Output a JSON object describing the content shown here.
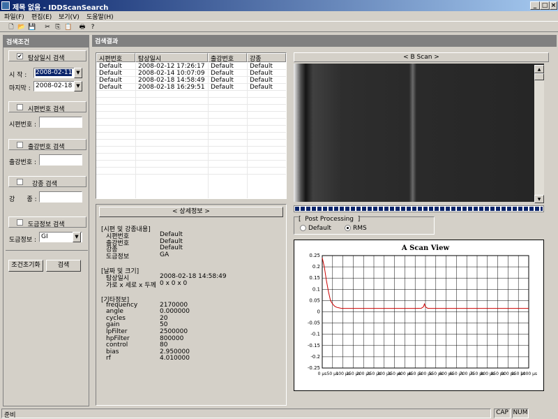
{
  "window": {
    "title": "제목 없음 - IDDScanSearch"
  },
  "menu": [
    "파일(F)",
    "편집(E)",
    "보기(V)",
    "도움말(H)"
  ],
  "left": {
    "header": "검색조건",
    "date_search": {
      "label": "탐상일시 검색",
      "checked": true,
      "start_label": "시  작 :",
      "start_value": "2008-02-11",
      "end_label": "마지막 :",
      "end_value": "2008-02-18"
    },
    "specimen_search": {
      "label": "시편번호 검색",
      "field_label": "시편번호 :"
    },
    "heat_search": {
      "label": "출강번호 검색",
      "field_label": "출강번호 :"
    },
    "grade_search": {
      "label": "강종 검색",
      "field_label": "강      종 :"
    },
    "plating_search": {
      "label": "도금정보 검색",
      "field_label": "도금정보 :",
      "value": "GI"
    },
    "reset_button": "조건초기화",
    "search_button": "검색"
  },
  "results": {
    "header": "검색결과",
    "columns": [
      "시편번호",
      "탐상일시",
      "출강번호",
      "강종"
    ],
    "rows": [
      [
        "Default",
        "2008-02-12 17:26:17",
        "Default",
        "Default"
      ],
      [
        "Default",
        "2008-02-14 10:07:09",
        "Default",
        "Default"
      ],
      [
        "Default",
        "2008-02-18 14:58:49",
        "Default",
        "Default"
      ],
      [
        "Default",
        "2008-02-18 16:29:51",
        "Default",
        "Default"
      ]
    ]
  },
  "detail": {
    "title": "< 상세정보 >",
    "sec1": "[시편 및 강종내용]",
    "sec1_rows": [
      [
        "시편번호",
        "Default"
      ],
      [
        "출강번호",
        "Default"
      ],
      [
        "강종",
        "Default"
      ],
      [
        "도금정보",
        "GA"
      ]
    ],
    "sec2": "[날짜 및 크기]",
    "sec2_rows": [
      [
        "탐상일시",
        "2008-02-18 14:58:49"
      ],
      [
        "가로 x 세로 x 두께",
        "0 x 0 x 0"
      ]
    ],
    "sec3": "[기타정보]",
    "sec3_rows": [
      [
        "frequency",
        "2170000"
      ],
      [
        "angle",
        "0.000000"
      ],
      [
        "cycles",
        "20"
      ],
      [
        "gain",
        "50"
      ],
      [
        "lpFilter",
        "2500000"
      ],
      [
        "hpFilter",
        "800000"
      ],
      [
        "control",
        "80"
      ],
      [
        "bias",
        "2.950000"
      ],
      [
        "rf",
        "4.010000"
      ]
    ]
  },
  "bscan": {
    "title": "< B Scan >"
  },
  "postproc": {
    "title": "[  Post Processing  ]",
    "opt1": "Default",
    "opt2": "RMS",
    "selected": "RMS"
  },
  "chart_data": {
    "type": "line",
    "title": "A Scan View",
    "xlabel": "",
    "ylabel": "",
    "xlim": [
      0,
      1000
    ],
    "ylim": [
      -0.25,
      0.25
    ],
    "x_ticks": [
      "0 µs",
      "50 µs",
      "100 µs",
      "150 µs",
      "200 µs",
      "250 µs",
      "300 µs",
      "350 µs",
      "400 µs",
      "450 µs",
      "500 µs",
      "550 µs",
      "600 µs",
      "650 µs",
      "700 µs",
      "750 µs",
      "800 µs",
      "850 µs",
      "900 µs",
      "950 µs",
      "1000 µs"
    ],
    "y_ticks": [
      "0.25",
      "0.2",
      "0.15",
      "0.1",
      "0.05",
      "0",
      "-0.05",
      "-0.1",
      "-0.15",
      "-0.2",
      "-0.25"
    ],
    "grid": true,
    "series": [
      {
        "color": "#cc0000",
        "x": [
          0,
          10,
          20,
          30,
          40,
          50,
          60,
          70,
          80,
          90,
          100,
          150,
          200,
          300,
          400,
          450,
          480,
          490,
          495,
          500,
          510,
          520,
          600,
          700,
          800,
          900,
          1000
        ],
        "y": [
          0.24,
          0.2,
          0.14,
          0.09,
          0.05,
          0.035,
          0.025,
          0.02,
          0.018,
          0.016,
          0.015,
          0.015,
          0.015,
          0.015,
          0.015,
          0.015,
          0.016,
          0.022,
          0.035,
          0.022,
          0.016,
          0.015,
          0.015,
          0.015,
          0.015,
          0.015,
          0.015
        ]
      }
    ]
  },
  "status": {
    "text": "준비",
    "cap": "CAP",
    "num": "NUM"
  }
}
